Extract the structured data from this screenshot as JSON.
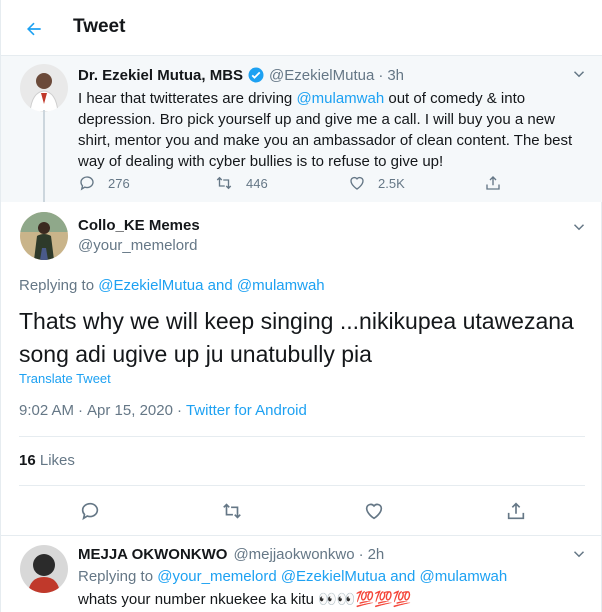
{
  "header": {
    "title": "Tweet"
  },
  "parent_tweet": {
    "display_name": "Dr. Ezekiel Mutua, MBS",
    "handle": "@EzekielMutua",
    "time": "3h",
    "text_before": "I hear that twitterates are driving ",
    "mention": "@mulamwah",
    "text_after": " out of comedy & into depression. Bro pick yourself up and give me a call. I will buy you a new shirt, mentor you and make you an ambassador of clean content. The best way of dealing with cyber bullies is to refuse to give up!",
    "replies": "276",
    "retweets": "446",
    "likes": "2.5K"
  },
  "main_tweet": {
    "display_name": "Collo_KE Memes",
    "handle": "@your_memelord",
    "replying_prefix": "Replying to ",
    "replying_to_1": "@EzekielMutua",
    "replying_and": " and ",
    "replying_to_2": "@mulamwah",
    "text": "Thats why we will keep singing ...nikikupea utawezana song adi ugive up ju unatubully pia",
    "translate_label": "Translate Tweet",
    "time": "9:02 AM",
    "date": "Apr 15, 2020",
    "source": "Twitter for Android",
    "likes_count": "16",
    "likes_label": " Likes"
  },
  "reply": {
    "display_name": "MEJJA OKWONKWO",
    "handle": "@mejjaokwonkwo",
    "time": "2h",
    "replying_prefix": "Replying to ",
    "replying_to_1": "@your_memelord",
    "replying_to_2": "@EzekielMutua",
    "replying_and": " and ",
    "replying_to_3": "@mulamwah",
    "text": "whats your number nkuekee ka kitu 👀👀💯💯💯"
  },
  "colors": {
    "accent": "#1da1f2",
    "secondary_text": "#657786",
    "border": "#e6ecf0"
  }
}
